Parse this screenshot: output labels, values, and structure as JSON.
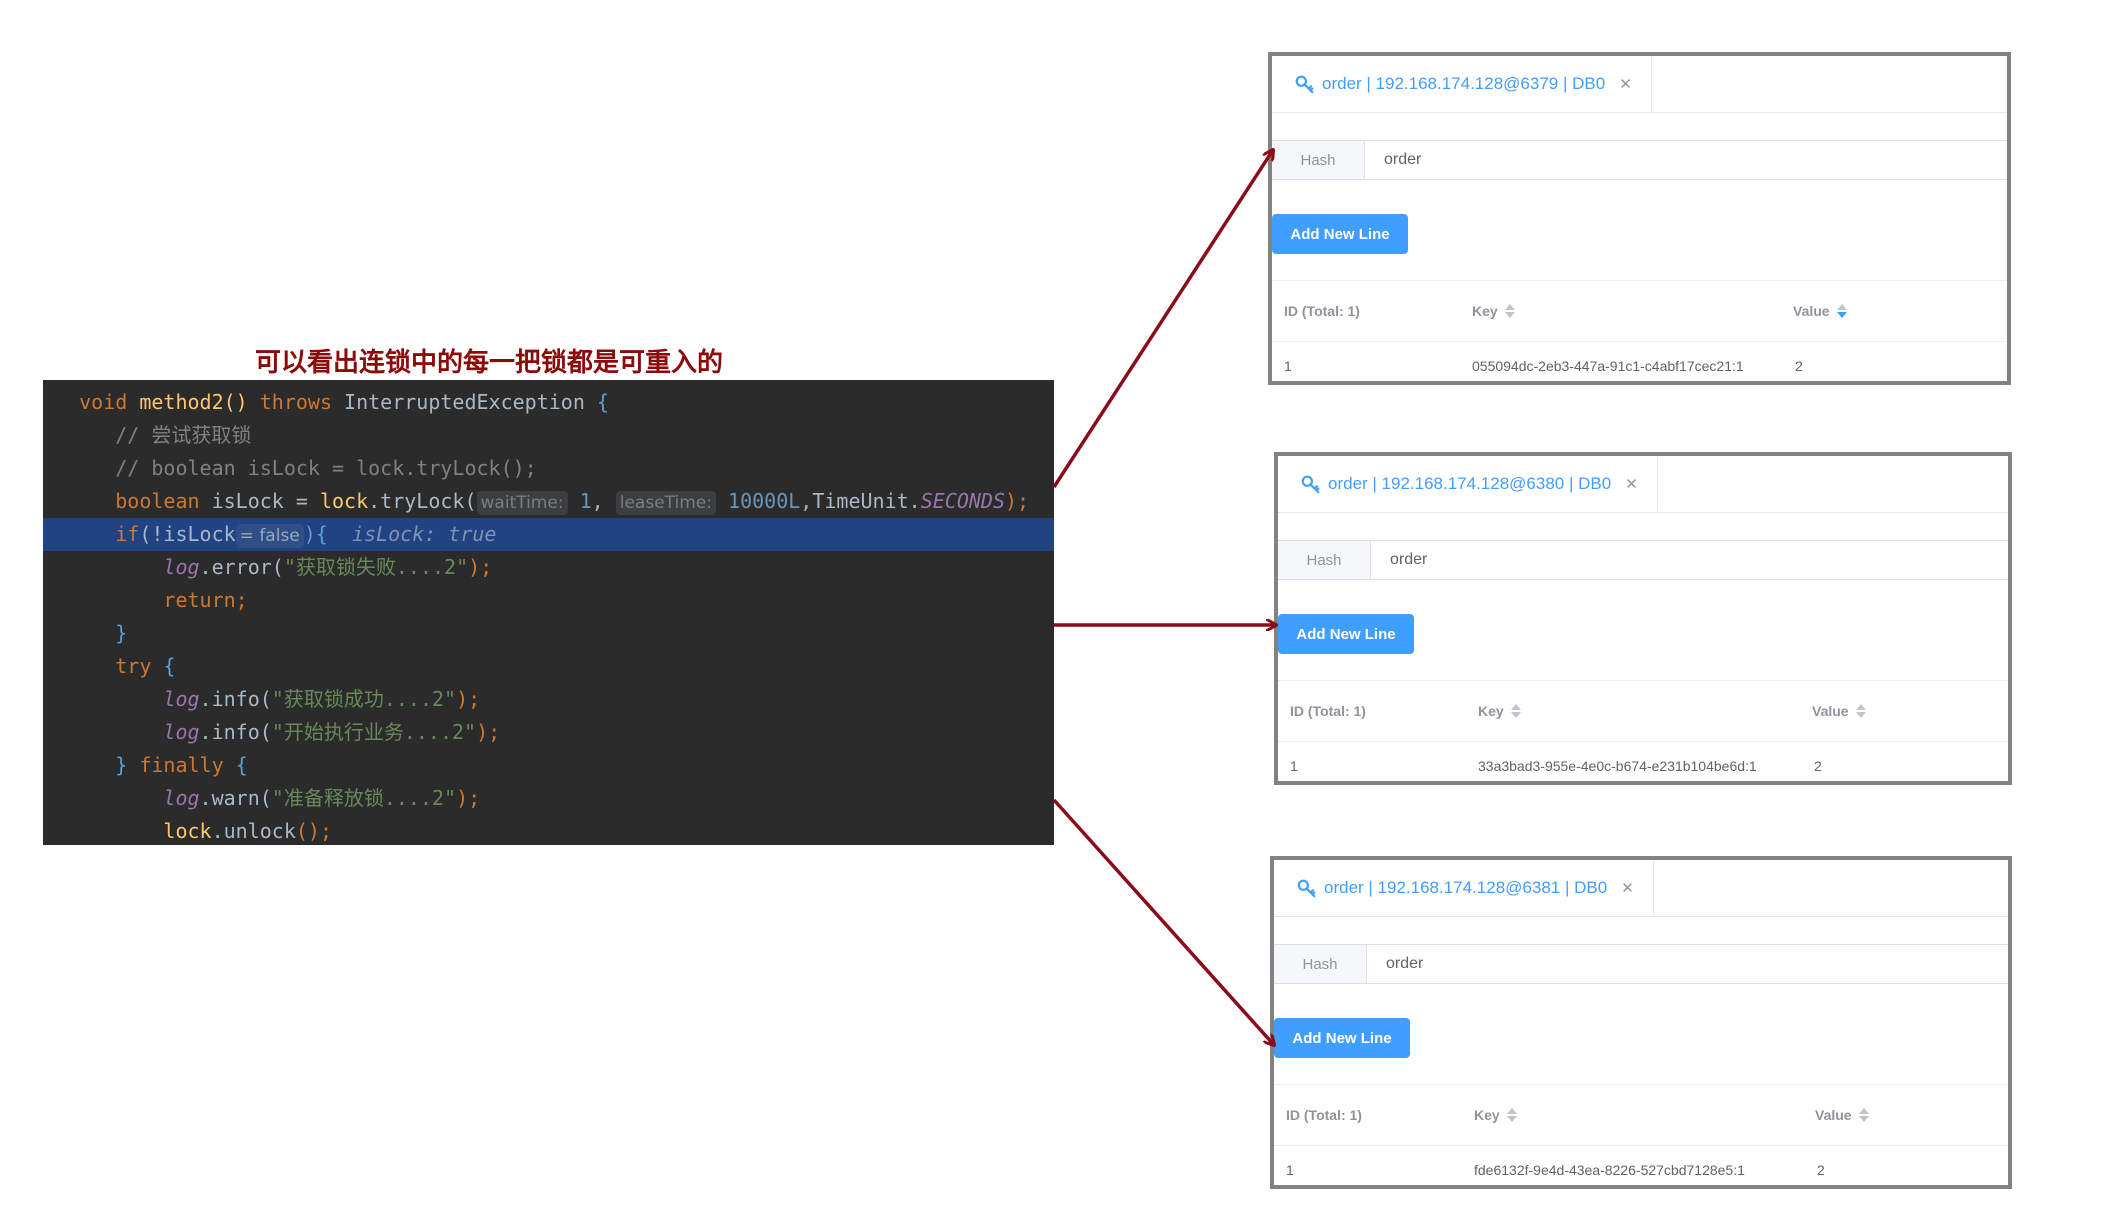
{
  "caption": "可以看出连锁中的每一把锁都是可重入的",
  "code": {
    "line1": {
      "kw_void": "void",
      "method": "method2",
      "parens": "() ",
      "kw_throws": "throws",
      "exc": " InterruptedException ",
      "brace": "{"
    },
    "line2": "// 尝试获取锁",
    "line3": "// boolean isLock = lock.tryLock();",
    "line4": {
      "kw_boolean": "boolean",
      "var": " isLock = ",
      "obj": "lock",
      "call": ".tryLock(",
      "hint_wait": "waitTime:",
      "arg1": "1",
      "comma1": ",",
      "hint_lease": "leaseTime:",
      "arg2": "10000L",
      "comma2": ",TimeUnit.",
      "enum": "SECONDS",
      "end": ");"
    },
    "line5": {
      "kw_if": "if",
      "cond": "(!isLock",
      "inline_hint": "= false",
      "close": "){",
      "debug_val": "isLock: true"
    },
    "line6": {
      "log": "log",
      "method": ".error(",
      "str": "\"获取锁失败....2\"",
      "end": ");"
    },
    "line7": {
      "kw_return": "return",
      "end": ";"
    },
    "line8": "}",
    "line9": {
      "kw_try": "try",
      "brace": " {"
    },
    "line10": {
      "log": "log",
      "method": ".info(",
      "str": "\"获取锁成功....2\"",
      "end": ");"
    },
    "line11": {
      "log": "log",
      "method": ".info(",
      "str": "\"开始执行业务....2\"",
      "end": ");"
    },
    "line12": {
      "brace1": "} ",
      "kw_finally": "finally",
      "brace2": " {"
    },
    "line13": {
      "log": "log",
      "method": ".warn(",
      "str": "\"准备释放锁....2\"",
      "end": ");"
    },
    "line14": {
      "obj": "lock",
      "call": ".unlock",
      "end": "();"
    }
  },
  "panels": [
    {
      "tab_title": "order | 192.168.174.128@6379 | DB0",
      "type": "Hash",
      "key": "order",
      "add_button": "Add New Line",
      "columns": {
        "id": "ID (Total: 1)",
        "key": "Key",
        "value": "Value"
      },
      "row": {
        "id": "1",
        "key": "055094dc-2eb3-447a-91c1-c4abf17cec21:1",
        "value": "2"
      }
    },
    {
      "tab_title": "order | 192.168.174.128@6380 | DB0",
      "type": "Hash",
      "key": "order",
      "add_button": "Add New Line",
      "columns": {
        "id": "ID (Total: 1)",
        "key": "Key",
        "value": "Value"
      },
      "row": {
        "id": "1",
        "key": "33a3bad3-955e-4e0c-b674-e231b104be6d:1",
        "value": "2"
      }
    },
    {
      "tab_title": "order | 192.168.174.128@6381 | DB0",
      "type": "Hash",
      "key": "order",
      "add_button": "Add New Line",
      "columns": {
        "id": "ID (Total: 1)",
        "key": "Key",
        "value": "Value"
      },
      "row": {
        "id": "1",
        "key": "fde6132f-9e4d-43ea-8226-527cbd7128e5:1",
        "value": "2"
      }
    }
  ],
  "icons": {
    "tab_icon": "key-icon",
    "close": "close-icon",
    "sort": "sort-icon"
  },
  "colors": {
    "accent": "#409eff",
    "arrow": "#8b0b1a",
    "caption": "#8b0b0b",
    "editor_bg": "#2b2b2b",
    "selection": "#214283"
  }
}
